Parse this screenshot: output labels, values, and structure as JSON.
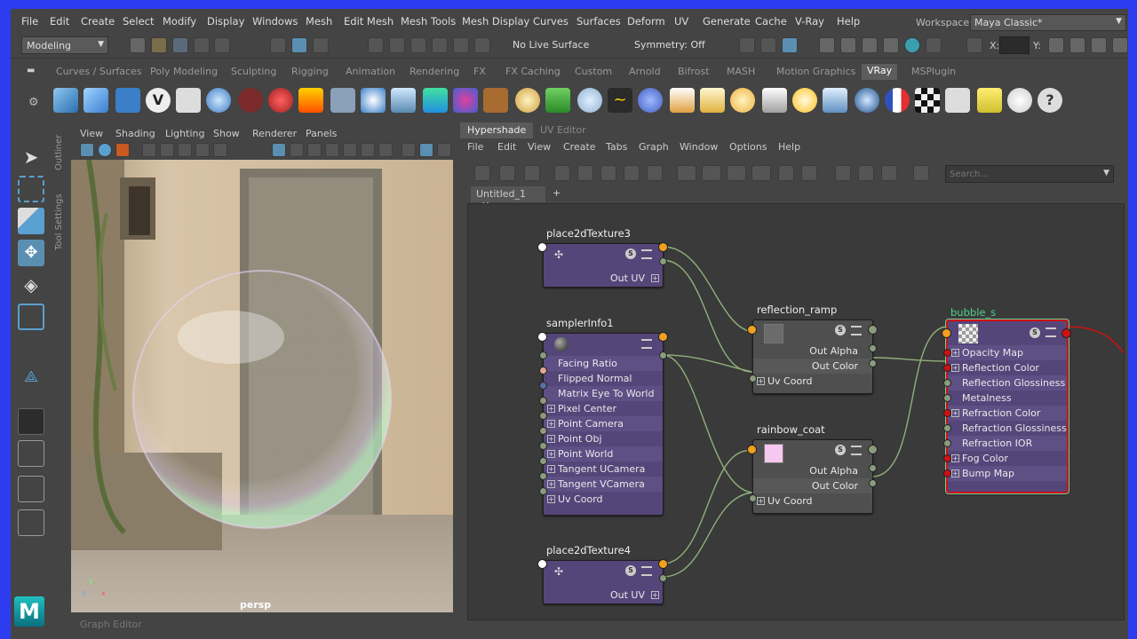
{
  "menubar": {
    "items": [
      "File",
      "Edit",
      "Create",
      "Select",
      "Modify",
      "Display",
      "Windows",
      "Mesh",
      "Edit Mesh",
      "Mesh Tools",
      "Mesh Display",
      "Curves",
      "Surfaces",
      "Deform",
      "UV",
      "Generate",
      "Cache",
      "V-Ray",
      "Help"
    ],
    "workspace_label": "Workspace :",
    "workspace_value": "Maya Classic*"
  },
  "statusline": {
    "mode": "Modeling",
    "live_surface": "No Live Surface",
    "symmetry": "Symmetry: Off",
    "x_label": "X:",
    "y_label": "Y:"
  },
  "shelf": {
    "tabs": [
      "Curves / Surfaces",
      "Poly Modeling",
      "Sculpting",
      "Rigging",
      "Animation",
      "Rendering",
      "FX",
      "FX Caching",
      "Custom",
      "Arnold",
      "Bifrost",
      "MASH",
      "Motion Graphics",
      "VRay",
      "MSPlugin"
    ],
    "active_tab": "VRay"
  },
  "sidetabs": {
    "outliner": "Outliner",
    "tool_settings": "Tool Settings"
  },
  "viewport": {
    "menu": [
      "View",
      "Shading",
      "Lighting",
      "Show",
      "Renderer",
      "Panels"
    ],
    "camera_label": "persp",
    "axis_y": "y",
    "axis_z": "z",
    "axis_x": "x"
  },
  "hypershade": {
    "tabs": [
      "Hypershade",
      "UV Editor"
    ],
    "active_tab": "Hypershade",
    "menu": [
      "File",
      "Edit",
      "View",
      "Create",
      "Tabs",
      "Graph",
      "Window",
      "Options",
      "Help"
    ],
    "search_placeholder": "Search...",
    "doc_tab": "Untitled_1",
    "doc_tab_close": "✕",
    "doc_tab_add": "+"
  },
  "nodes": {
    "place2dTexture3": {
      "title": "place2dTexture3",
      "out": "Out UV"
    },
    "samplerInfo1": {
      "title": "samplerInfo1",
      "attrs": [
        "Facing Ratio",
        "Flipped Normal",
        "Matrix Eye To World",
        "Pixel Center",
        "Point Camera",
        "Point Obj",
        "Point World",
        "Tangent UCamera",
        "Tangent VCamera",
        "Uv Coord"
      ]
    },
    "place2dTexture4": {
      "title": "place2dTexture4",
      "out": "Out UV"
    },
    "reflection_ramp": {
      "title": "reflection_ramp",
      "out_alpha": "Out Alpha",
      "out_color": "Out Color",
      "uv_coord": "Uv Coord"
    },
    "rainbow_coat": {
      "title": "rainbow_coat",
      "out_alpha": "Out Alpha",
      "out_color": "Out Color",
      "uv_coord": "Uv Coord"
    },
    "bubble_s": {
      "title": "bubble_s",
      "attrs": [
        "Opacity Map",
        "Reflection Color",
        "Reflection Glossiness",
        "Metalness",
        "Refraction Color",
        "Refraction Glossiness",
        "Refraction IOR",
        "Fog Color",
        "Bump Map"
      ]
    }
  },
  "graph_editor_label": "Graph Editor",
  "colors": {
    "accent_blue": "#2e3cf0",
    "node_purple": "#55467a",
    "node_gray": "#4f4f4f",
    "port_orange": "#f2a020",
    "port_green": "#8a9c7c",
    "port_red": "#d01010",
    "connection": "#8fb07a",
    "selected_border": "#d01010",
    "bubble_title": "#4fd08a",
    "rainbow_swatch": "#f7c8ef",
    "ramp_swatch": "#6b6b6b"
  }
}
